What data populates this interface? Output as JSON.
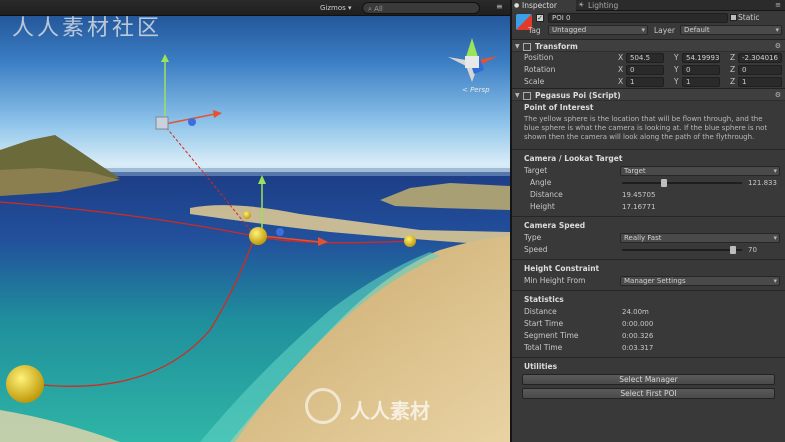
{
  "scene": {
    "gizmos_label": "Gizmos ▾",
    "search_placeholder": "All",
    "persp_label": "< Persp",
    "watermark_top": "人人素材社区",
    "watermark_bottom": "人人素材"
  },
  "inspector": {
    "tabs": [
      {
        "label": "Inspector"
      },
      {
        "label": "Lighting"
      }
    ],
    "gameobject": {
      "name": "POI 0",
      "static_label": "Static",
      "tag_label": "Tag",
      "tag_value": "Untagged",
      "layer_label": "Layer",
      "layer_value": "Default"
    },
    "transform": {
      "title": "Transform",
      "position": {
        "label": "Position",
        "x": "504.5",
        "y": "54.19993",
        "z": "-2.304016"
      },
      "rotation": {
        "label": "Rotation",
        "x": "0",
        "y": "0",
        "z": "0"
      },
      "scale": {
        "label": "Scale",
        "x": "1",
        "y": "1",
        "z": "1"
      }
    },
    "script": {
      "title": "Pegasus Poi (Script)",
      "poi_title": "Point of Interest",
      "description": "The yellow sphere is the location that will be flown through, and the blue sphere is what the camera is looking at. If the blue sphere is not shown then the camera will look along the path of the flythrough.",
      "camera_lookat": {
        "title": "Camera / Lookat Target",
        "target_label": "Target",
        "target_value": "Target",
        "angle_label": "Angle",
        "angle_value": "121.833",
        "angle_fraction": 0.34,
        "distance_label": "Distance",
        "distance_value": "19.45705",
        "height_label": "Height",
        "height_value": "17.16771"
      },
      "camera_speed": {
        "title": "Camera Speed",
        "type_label": "Type",
        "type_value": "Really Fast",
        "speed_label": "Speed",
        "speed_value": "70",
        "speed_fraction": 0.95
      },
      "height_constraint": {
        "title": "Height Constraint",
        "min_height_label": "Min Height From",
        "min_height_value": "Manager Settings"
      },
      "statistics": {
        "title": "Statistics",
        "rows": [
          {
            "label": "Distance",
            "value": "24.00m"
          },
          {
            "label": "Start Time",
            "value": "0:00.000"
          },
          {
            "label": "Segment Time",
            "value": "0:00.326"
          },
          {
            "label": "Total Time",
            "value": "0:03.317"
          }
        ]
      },
      "utilities": {
        "title": "Utilities",
        "buttons": [
          "Select Manager",
          "Select First POI"
        ]
      }
    }
  }
}
